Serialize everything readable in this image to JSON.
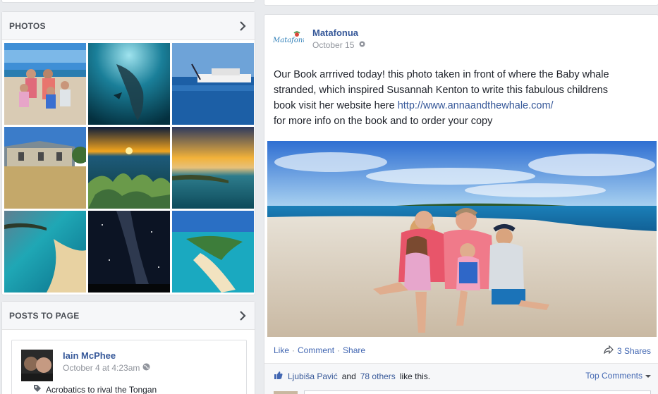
{
  "left": {
    "photos_title": "PHOTOS",
    "posts_title": "POSTS TO PAGE",
    "posts_item": {
      "author": "Iain McPhee",
      "time": "October 4 at 4:23am",
      "text": "Acrobatics to rival the Tongan"
    }
  },
  "post": {
    "logo_text": "Matafonua",
    "page_name": "Matafonua",
    "time": "October 15",
    "text_line1": "Our Book arrrived today! this photo taken in front of where the Baby whale",
    "text_line2": "stranded, which inspired Susannah Kenton to write this fabulous childrens",
    "text_line3_prefix": "book visit her website here ",
    "text_link": "http://www.annaandthewhale.com/",
    "text_line4": "for more info on the book and to order your copy",
    "actions": {
      "like": "Like",
      "comment": "Comment",
      "share": "Share",
      "separator": "·"
    },
    "shares": "3 Shares",
    "likes_name": "Ljubiša Pavić",
    "likes_and": "and",
    "likes_others": "78 others",
    "likes_suffix": "like this.",
    "top_comments": "Top Comments"
  }
}
